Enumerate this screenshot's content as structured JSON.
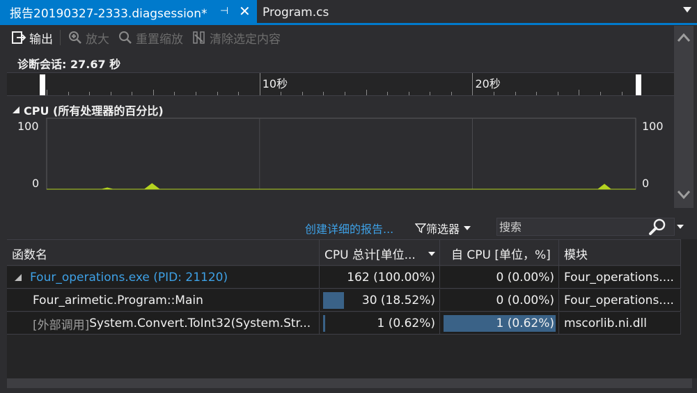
{
  "tabs": {
    "active": {
      "title": "报告20190327-2333.diagsession*"
    },
    "inactive": {
      "title": "Program.cs"
    }
  },
  "toolbar": {
    "output_label": "输出",
    "zoom_in_label": "放大",
    "reset_zoom_label": "重置缩放",
    "clear_selection_label": "清除选定内容"
  },
  "session": {
    "label": "诊断会话: 27.67 秒"
  },
  "ruler": {
    "marks": [
      "10秒",
      "20秒"
    ]
  },
  "cpu_graph": {
    "title": "CPU (所有处理器的百分比)",
    "y_max_left": "100",
    "y_min_left": "0",
    "y_max_right": "100",
    "y_min_right": "0",
    "series_color": "#b5d320"
  },
  "chart_data": {
    "type": "area",
    "title": "CPU (所有处理器的百分比)",
    "ylim": [
      0,
      100
    ],
    "xlim": [
      0,
      27.67
    ],
    "x_tick_labels": [
      "10秒",
      "20秒"
    ],
    "series": [
      {
        "x": [
          0,
          2.6,
          2.85,
          3.1,
          4.6,
          4.95,
          5.3,
          25.9,
          26.2,
          26.5,
          27.67
        ],
        "y": [
          0,
          0,
          2,
          0,
          0,
          8,
          0,
          0,
          7,
          0,
          0
        ]
      }
    ]
  },
  "lower_toolbar": {
    "create_report_link": "创建详细的报告...",
    "filter_label": "筛选器",
    "search_placeholder": "搜索"
  },
  "table": {
    "headers": [
      "函数名",
      "CPU 总计[单位...",
      "自 CPU [单位，%]",
      "模块"
    ],
    "rows": [
      {
        "name_prefix": "",
        "name": "Four_operations.exe (PID: 21120)",
        "total": "162 (100.00%)",
        "total_frac": 1.0,
        "self": "0 (0.00%)",
        "self_frac": 0.0,
        "module": "Four_operations...."
      },
      {
        "name_prefix": "",
        "name": "Four_arimetic.Program::Main",
        "total": "30 (18.52%)",
        "total_frac": 0.1852,
        "self": "0 (0.00%)",
        "self_frac": 0.0,
        "module": "Four_operations...."
      },
      {
        "name_prefix": "[外部调用] ",
        "name": "System.Convert.ToInt32(System.Str...",
        "total": "1 (0.62%)",
        "total_frac": 0.0062,
        "self": "1 (0.62%)",
        "self_frac": 1.0,
        "module": "mscorlib.ni.dll"
      }
    ]
  }
}
